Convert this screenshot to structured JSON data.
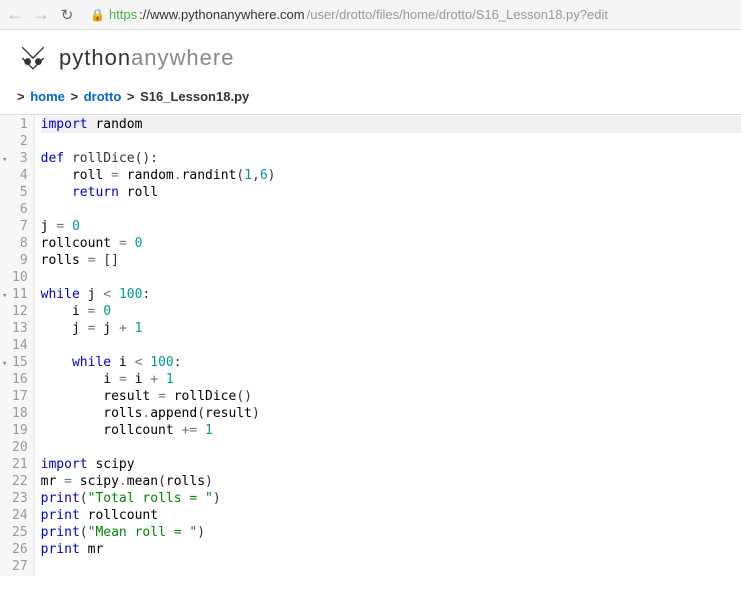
{
  "url": {
    "protocol": "https",
    "domain": "://www.pythonanywhere.com",
    "path": "/user/drotto/files/home/drotto/S16_Lesson18.py?edit"
  },
  "logo": {
    "part1": "python",
    "part2": "anywhere"
  },
  "breadcrumb": {
    "sep": ">",
    "items": [
      "home",
      "drotto",
      "S16_Lesson18.py"
    ]
  },
  "code_lines": [
    {
      "num": 1,
      "fold": false,
      "active": true,
      "tokens": [
        {
          "t": "kw",
          "v": "import"
        },
        {
          "t": "txt",
          "v": " random"
        }
      ]
    },
    {
      "num": 2,
      "fold": false,
      "tokens": []
    },
    {
      "num": 3,
      "fold": true,
      "tokens": [
        {
          "t": "kw",
          "v": "def"
        },
        {
          "t": "txt",
          "v": " "
        },
        {
          "t": "name",
          "v": "rollDice"
        },
        {
          "t": "paren",
          "v": "():"
        }
      ]
    },
    {
      "num": 4,
      "fold": false,
      "tokens": [
        {
          "t": "txt",
          "v": "    roll "
        },
        {
          "t": "op",
          "v": "="
        },
        {
          "t": "txt",
          "v": " random"
        },
        {
          "t": "op",
          "v": "."
        },
        {
          "t": "txt",
          "v": "randint"
        },
        {
          "t": "paren",
          "v": "("
        },
        {
          "t": "num",
          "v": "1"
        },
        {
          "t": "paren",
          "v": ","
        },
        {
          "t": "num",
          "v": "6"
        },
        {
          "t": "paren",
          "v": ")"
        }
      ]
    },
    {
      "num": 5,
      "fold": false,
      "tokens": [
        {
          "t": "txt",
          "v": "    "
        },
        {
          "t": "kw",
          "v": "return"
        },
        {
          "t": "txt",
          "v": " roll"
        }
      ]
    },
    {
      "num": 6,
      "fold": false,
      "tokens": []
    },
    {
      "num": 7,
      "fold": false,
      "tokens": [
        {
          "t": "txt",
          "v": "j "
        },
        {
          "t": "op",
          "v": "="
        },
        {
          "t": "txt",
          "v": " "
        },
        {
          "t": "num",
          "v": "0"
        }
      ]
    },
    {
      "num": 8,
      "fold": false,
      "tokens": [
        {
          "t": "txt",
          "v": "rollcount "
        },
        {
          "t": "op",
          "v": "="
        },
        {
          "t": "txt",
          "v": " "
        },
        {
          "t": "num",
          "v": "0"
        }
      ]
    },
    {
      "num": 9,
      "fold": false,
      "tokens": [
        {
          "t": "txt",
          "v": "rolls "
        },
        {
          "t": "op",
          "v": "="
        },
        {
          "t": "txt",
          "v": " "
        },
        {
          "t": "paren",
          "v": "[]"
        }
      ]
    },
    {
      "num": 10,
      "fold": false,
      "tokens": []
    },
    {
      "num": 11,
      "fold": true,
      "tokens": [
        {
          "t": "kw",
          "v": "while"
        },
        {
          "t": "txt",
          "v": " j "
        },
        {
          "t": "op",
          "v": "<"
        },
        {
          "t": "txt",
          "v": " "
        },
        {
          "t": "num",
          "v": "100"
        },
        {
          "t": "paren",
          "v": ":"
        }
      ]
    },
    {
      "num": 12,
      "fold": false,
      "tokens": [
        {
          "t": "txt",
          "v": "    i "
        },
        {
          "t": "op",
          "v": "="
        },
        {
          "t": "txt",
          "v": " "
        },
        {
          "t": "num",
          "v": "0"
        }
      ]
    },
    {
      "num": 13,
      "fold": false,
      "tokens": [
        {
          "t": "txt",
          "v": "    j "
        },
        {
          "t": "op",
          "v": "="
        },
        {
          "t": "txt",
          "v": " j "
        },
        {
          "t": "op",
          "v": "+"
        },
        {
          "t": "txt",
          "v": " "
        },
        {
          "t": "num",
          "v": "1"
        }
      ]
    },
    {
      "num": 14,
      "fold": false,
      "tokens": []
    },
    {
      "num": 15,
      "fold": true,
      "tokens": [
        {
          "t": "txt",
          "v": "    "
        },
        {
          "t": "kw",
          "v": "while"
        },
        {
          "t": "txt",
          "v": " i "
        },
        {
          "t": "op",
          "v": "<"
        },
        {
          "t": "txt",
          "v": " "
        },
        {
          "t": "num",
          "v": "100"
        },
        {
          "t": "paren",
          "v": ":"
        }
      ]
    },
    {
      "num": 16,
      "fold": false,
      "tokens": [
        {
          "t": "txt",
          "v": "        i "
        },
        {
          "t": "op",
          "v": "="
        },
        {
          "t": "txt",
          "v": " i "
        },
        {
          "t": "op",
          "v": "+"
        },
        {
          "t": "txt",
          "v": " "
        },
        {
          "t": "num",
          "v": "1"
        }
      ]
    },
    {
      "num": 17,
      "fold": false,
      "tokens": [
        {
          "t": "txt",
          "v": "        result "
        },
        {
          "t": "op",
          "v": "="
        },
        {
          "t": "txt",
          "v": " rollDice"
        },
        {
          "t": "paren",
          "v": "()"
        }
      ]
    },
    {
      "num": 18,
      "fold": false,
      "tokens": [
        {
          "t": "txt",
          "v": "        rolls"
        },
        {
          "t": "op",
          "v": "."
        },
        {
          "t": "txt",
          "v": "append"
        },
        {
          "t": "paren",
          "v": "("
        },
        {
          "t": "txt",
          "v": "result"
        },
        {
          "t": "paren",
          "v": ")"
        }
      ]
    },
    {
      "num": 19,
      "fold": false,
      "tokens": [
        {
          "t": "txt",
          "v": "        rollcount "
        },
        {
          "t": "op",
          "v": "+="
        },
        {
          "t": "txt",
          "v": " "
        },
        {
          "t": "num",
          "v": "1"
        }
      ]
    },
    {
      "num": 20,
      "fold": false,
      "tokens": []
    },
    {
      "num": 21,
      "fold": false,
      "tokens": [
        {
          "t": "kw",
          "v": "import"
        },
        {
          "t": "txt",
          "v": " scipy"
        }
      ]
    },
    {
      "num": 22,
      "fold": false,
      "tokens": [
        {
          "t": "txt",
          "v": "mr "
        },
        {
          "t": "op",
          "v": "="
        },
        {
          "t": "txt",
          "v": " scipy"
        },
        {
          "t": "op",
          "v": "."
        },
        {
          "t": "txt",
          "v": "mean"
        },
        {
          "t": "paren",
          "v": "("
        },
        {
          "t": "txt",
          "v": "rolls"
        },
        {
          "t": "paren",
          "v": ")"
        }
      ]
    },
    {
      "num": 23,
      "fold": false,
      "tokens": [
        {
          "t": "kw",
          "v": "print"
        },
        {
          "t": "paren",
          "v": "("
        },
        {
          "t": "str",
          "v": "\"Total rolls = \""
        },
        {
          "t": "paren",
          "v": ")"
        }
      ]
    },
    {
      "num": 24,
      "fold": false,
      "tokens": [
        {
          "t": "kw",
          "v": "print"
        },
        {
          "t": "txt",
          "v": " rollcount"
        }
      ]
    },
    {
      "num": 25,
      "fold": false,
      "tokens": [
        {
          "t": "kw",
          "v": "print"
        },
        {
          "t": "paren",
          "v": "("
        },
        {
          "t": "str",
          "v": "\"Mean roll = \""
        },
        {
          "t": "paren",
          "v": ")"
        }
      ]
    },
    {
      "num": 26,
      "fold": false,
      "tokens": [
        {
          "t": "kw",
          "v": "print"
        },
        {
          "t": "txt",
          "v": " mr"
        }
      ]
    },
    {
      "num": 27,
      "fold": false,
      "tokens": []
    }
  ]
}
